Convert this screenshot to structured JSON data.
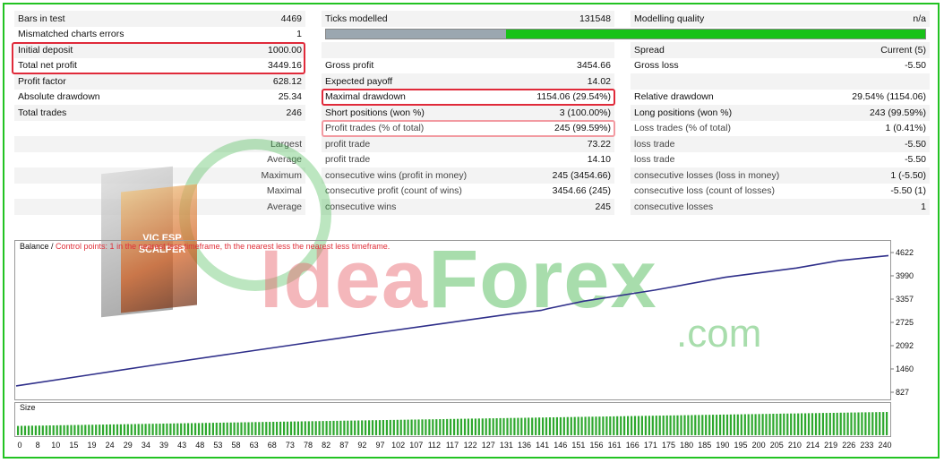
{
  "report": {
    "rows": [
      [
        "Bars in test",
        "4469",
        "Ticks modelled",
        "131548",
        "Modelling quality",
        "n/a"
      ],
      [
        "Mismatched charts errors",
        "1",
        "",
        "",
        "",
        ""
      ],
      [
        "Initial deposit",
        "1000.00",
        "",
        "",
        "Spread",
        "Current (5)"
      ],
      [
        "Total net profit",
        "3449.16",
        "Gross profit",
        "3454.66",
        "Gross loss",
        "-5.50"
      ],
      [
        "Profit factor",
        "628.12",
        "Expected payoff",
        "14.02",
        "",
        ""
      ],
      [
        "Absolute drawdown",
        "25.34",
        "Maximal drawdown",
        "1154.06 (29.54%)",
        "Relative drawdown",
        "29.54% (1154.06)"
      ],
      [
        "Total trades",
        "246",
        "Short positions (won %)",
        "3 (100.00%)",
        "Long positions (won %)",
        "243 (99.59%)"
      ],
      [
        "",
        "",
        "Profit trades (% of total)",
        "245 (99.59%)",
        "Loss trades (% of total)",
        "1 (0.41%)"
      ],
      [
        "",
        "Largest",
        "profit trade",
        "73.22",
        "loss trade",
        "-5.50"
      ],
      [
        "",
        "Average",
        "profit trade",
        "14.10",
        "loss trade",
        "-5.50"
      ],
      [
        "",
        "Maximum",
        "consecutive wins (profit in money)",
        "245 (3454.66)",
        "consecutive losses (loss in money)",
        "1 (-5.50)"
      ],
      [
        "",
        "Maximal",
        "consecutive profit (count of wins)",
        "3454.66 (245)",
        "consecutive loss (count of losses)",
        "-5.50 (1)"
      ],
      [
        "",
        "Average",
        "consecutive wins",
        "245",
        "consecutive losses",
        "1"
      ]
    ],
    "modelling_quality_fraction": 0.3
  },
  "colors": {
    "balance_line": "#2f2f8a",
    "size_bars": "#2ea82e",
    "highlight": "#e02a3a",
    "frame": "#22c322"
  },
  "watermark": {
    "brand_part1": "Idea",
    "brand_part2": "Forex",
    "suffix": ".com",
    "box_label": "VIC ESP SCALPER"
  },
  "chart_data": [
    {
      "type": "line",
      "title": "Balance / Control points: 1 in the nearest less timeframe, th the nearest less the nearest less timeframe.",
      "title_prefix": "Balance / ",
      "title_rest": "Control points: 1 in the nearest less timeframe, th the nearest less the nearest less timeframe.",
      "series": [
        {
          "x": [
            0,
            20,
            40,
            60,
            80,
            100,
            120,
            140,
            148,
            150,
            160,
            180,
            200,
            220,
            232,
            240,
            246
          ],
          "y": [
            1000,
            1290,
            1580,
            1860,
            2140,
            2420,
            2690,
            2960,
            3050,
            3100,
            3300,
            3600,
            3950,
            4200,
            4400,
            4480,
            4540
          ]
        }
      ],
      "xlim": [
        0,
        246
      ],
      "ylim": [
        827,
        4622
      ],
      "y_ticks": [
        4622,
        3990,
        3357,
        2725,
        2092,
        1460,
        827
      ]
    },
    {
      "type": "bar",
      "title": "Size",
      "x_ticks": [
        0,
        8,
        10,
        15,
        19,
        24,
        29,
        34,
        39,
        43,
        48,
        53,
        58,
        63,
        68,
        73,
        78,
        82,
        87,
        92,
        97,
        102,
        107,
        112,
        117,
        122,
        127,
        131,
        136,
        141,
        146,
        151,
        156,
        161,
        166,
        171,
        175,
        180,
        185,
        190,
        195,
        200,
        205,
        210,
        214,
        219,
        226,
        233,
        240
      ],
      "bar_count": 246,
      "size_start": 0.4,
      "size_end": 1.0
    }
  ]
}
